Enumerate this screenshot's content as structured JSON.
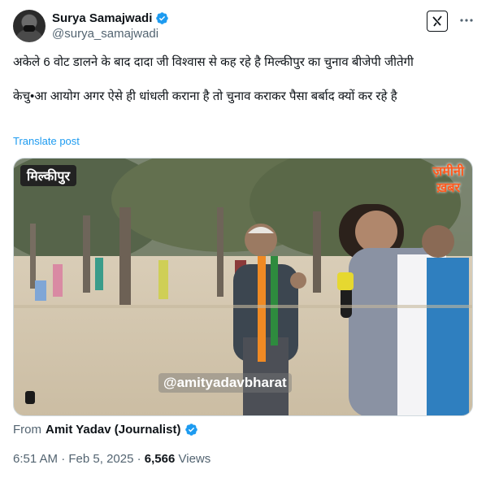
{
  "author": {
    "name": "Surya Samajwadi",
    "handle": "@surya_samajwadi"
  },
  "header": {
    "grok_button": "X",
    "more_icon": "more-horizontal-icon"
  },
  "tweet": {
    "paragraph1": "अकेले 6 वोट डालने के बाद दादा जी विश्वास से कह रहे है मिल्कीपुर का चुनाव बीजेपी जीतेगी",
    "paragraph2": "केचु•आ आयोग अगर ऐसे ही धांधली कराना है तो चुनाव कराकर पैसा बर्बाद क्यों कर रहे है",
    "translate_label": "Translate post"
  },
  "media": {
    "overlay_left": "मिल्कीपुर",
    "overlay_right_line1": "ज़मीनी",
    "overlay_right_line2": "ख़बर",
    "watermark": "@amityadavbharat"
  },
  "source": {
    "from_label": "From",
    "from_name": "Amit Yadav (Journalist)"
  },
  "meta": {
    "time": "6:51 AM",
    "separator1": " · ",
    "date": "Feb 5, 2025",
    "separator2": " · ",
    "views_count": "6,566",
    "views_label": " Views"
  },
  "colors": {
    "verified": "#1d9bf0",
    "link": "#1d9bf0",
    "secondary": "#536471",
    "overlay_brand": "#ff5a1f"
  }
}
